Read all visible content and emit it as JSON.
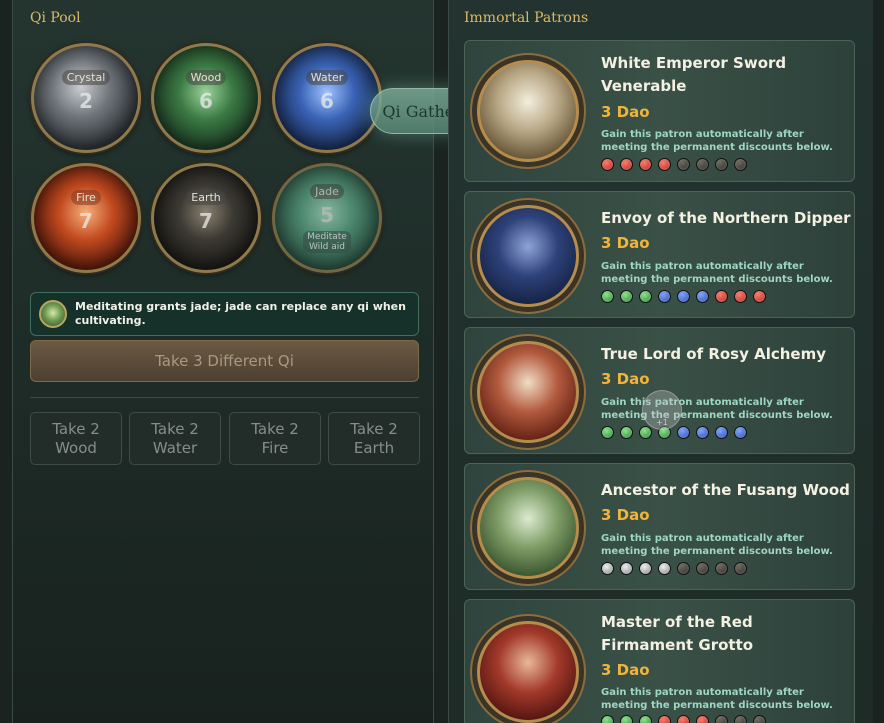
{
  "qi_pool": {
    "title": "Qi Pool",
    "tokens": [
      {
        "name": "Crystal",
        "count": "2"
      },
      {
        "name": "Wood",
        "count": "6"
      },
      {
        "name": "Water",
        "count": "6"
      },
      {
        "name": "Fire",
        "count": "7"
      },
      {
        "name": "Earth",
        "count": "7"
      },
      {
        "name": "Jade",
        "count": "5",
        "sub": "Meditate\nWild aid"
      }
    ],
    "floating_label": "Qi Gathered",
    "info_text": "Meditating grants jade; jade can replace any qi when cultivating.",
    "take3_label": "Take 3 Different Qi",
    "take2": [
      {
        "line1": "Take 2",
        "line2": "Wood"
      },
      {
        "line1": "Take 2",
        "line2": "Water"
      },
      {
        "line1": "Take 2",
        "line2": "Fire"
      },
      {
        "line1": "Take 2",
        "line2": "Earth"
      }
    ]
  },
  "patrons": {
    "title": "Immortal Patrons",
    "cards": [
      {
        "name": "White Emperor Sword Venerable",
        "dao": "3 Dao",
        "desc": "Gain this patron automatically after meeting the permanent discounts below.",
        "gems": [
          "fire",
          "fire",
          "fire",
          "fire",
          "earth",
          "earth",
          "earth",
          "earth"
        ]
      },
      {
        "name": "Envoy of the Northern Dipper",
        "dao": "3 Dao",
        "desc": "Gain this patron automatically after meeting the permanent discounts below.",
        "gems": [
          "wood",
          "wood",
          "wood",
          "water",
          "water",
          "water",
          "fire",
          "fire",
          "fire"
        ]
      },
      {
        "name": "True Lord of Rosy Alchemy",
        "dao": "3 Dao",
        "desc": "Gain this patron automatically after meeting the permanent discounts below.",
        "gems": [
          "wood",
          "wood",
          "wood",
          "wood",
          "water",
          "water",
          "water",
          "water"
        ]
      },
      {
        "name": "Ancestor of the Fusang Wood",
        "dao": "3 Dao",
        "desc": "Gain this patron automatically after meeting the permanent discounts below.",
        "gems": [
          "crystal",
          "crystal",
          "crystal",
          "crystal",
          "earth",
          "earth",
          "earth",
          "earth"
        ]
      },
      {
        "name": "Master of the Red Firmament Grotto",
        "dao": "3 Dao",
        "desc": "Gain this patron automatically after meeting the permanent discounts below.",
        "gems": [
          "wood",
          "wood",
          "wood",
          "fire",
          "fire",
          "fire",
          "earth",
          "earth",
          "earth"
        ]
      }
    ],
    "ghost_label": "+1"
  },
  "colors": {
    "accent": "#d9b96a",
    "dao": "#f0b43b",
    "desc": "#9ed6c3"
  }
}
